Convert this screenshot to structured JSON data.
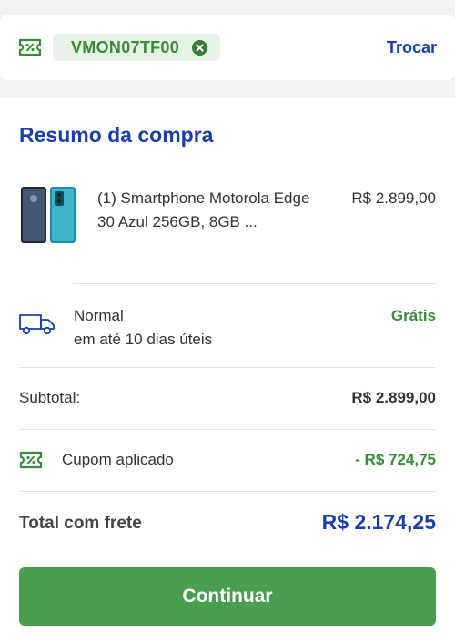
{
  "coupon": {
    "code": "VMON07TF00",
    "change_label": "Trocar",
    "icon": "coupon-ticket-icon",
    "remove_icon": "remove-circle-icon"
  },
  "summary": {
    "title": "Resumo da compra",
    "product": {
      "name": "(1) Smartphone Motorola Edge 30 Azul 256GB, 8GB ...",
      "price": "R$ 2.899,00",
      "image": "smartphone-thumbnail"
    },
    "shipping": {
      "method": "Normal",
      "eta": "em até 10 dias úteis",
      "price": "Grátis",
      "icon": "delivery-truck-icon"
    },
    "subtotal": {
      "label": "Subtotal:",
      "value": "R$ 2.899,00"
    },
    "discount": {
      "label": "Cupom aplicado",
      "value": "- R$ 724,75",
      "icon": "coupon-ticket-icon"
    },
    "total": {
      "label": "Total com frete",
      "value": "R$ 2.174,25"
    },
    "continue_label": "Continuar"
  },
  "colors": {
    "accent_blue": "#1a3faa",
    "accent_green": "#3a8a3a",
    "button_green": "#4a9e4f",
    "chip_bg": "#e6f2e6"
  }
}
